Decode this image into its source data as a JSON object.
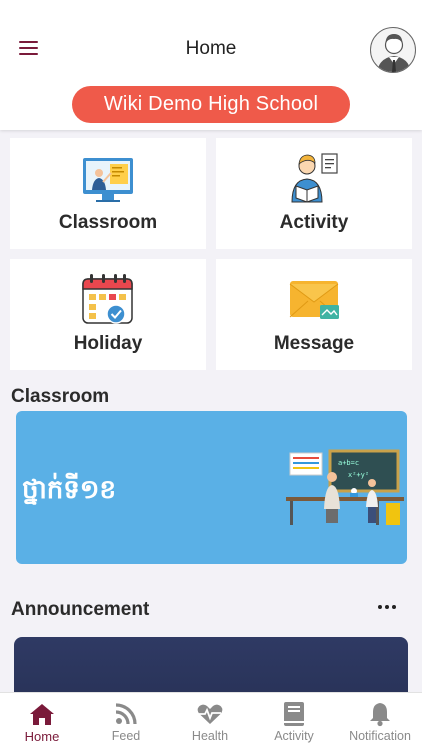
{
  "header": {
    "title": "Home",
    "school_name": "Wiki Demo High School",
    "menu_icon": "hamburger-icon",
    "avatar_icon": "user-avatar-icon"
  },
  "menu": [
    {
      "label": "Classroom",
      "icon": "classroom-icon"
    },
    {
      "label": "Activity",
      "icon": "activity-icon"
    },
    {
      "label": "Holiday",
      "icon": "calendar-icon"
    },
    {
      "label": "Message",
      "icon": "envelope-icon"
    }
  ],
  "classroom": {
    "heading": "Classroom",
    "banner_text": "ថ្នាក់ទី១ខ"
  },
  "announcement": {
    "heading": "Announcement",
    "more_icon": "more-dots-icon"
  },
  "tabs": [
    {
      "label": "Home",
      "icon": "home-icon",
      "active": true
    },
    {
      "label": "Feed",
      "icon": "rss-icon",
      "active": false
    },
    {
      "label": "Health",
      "icon": "heart-pulse-icon",
      "active": false
    },
    {
      "label": "Activity",
      "icon": "book-icon",
      "active": false
    },
    {
      "label": "Notification",
      "icon": "bell-icon",
      "active": false
    }
  ],
  "colors": {
    "accent": "#7a1a3a",
    "school_pill": "#ef5a4a",
    "banner": "#5ab0e6",
    "background": "#f3f2f7",
    "inactive_tab": "#8a8a8a"
  }
}
